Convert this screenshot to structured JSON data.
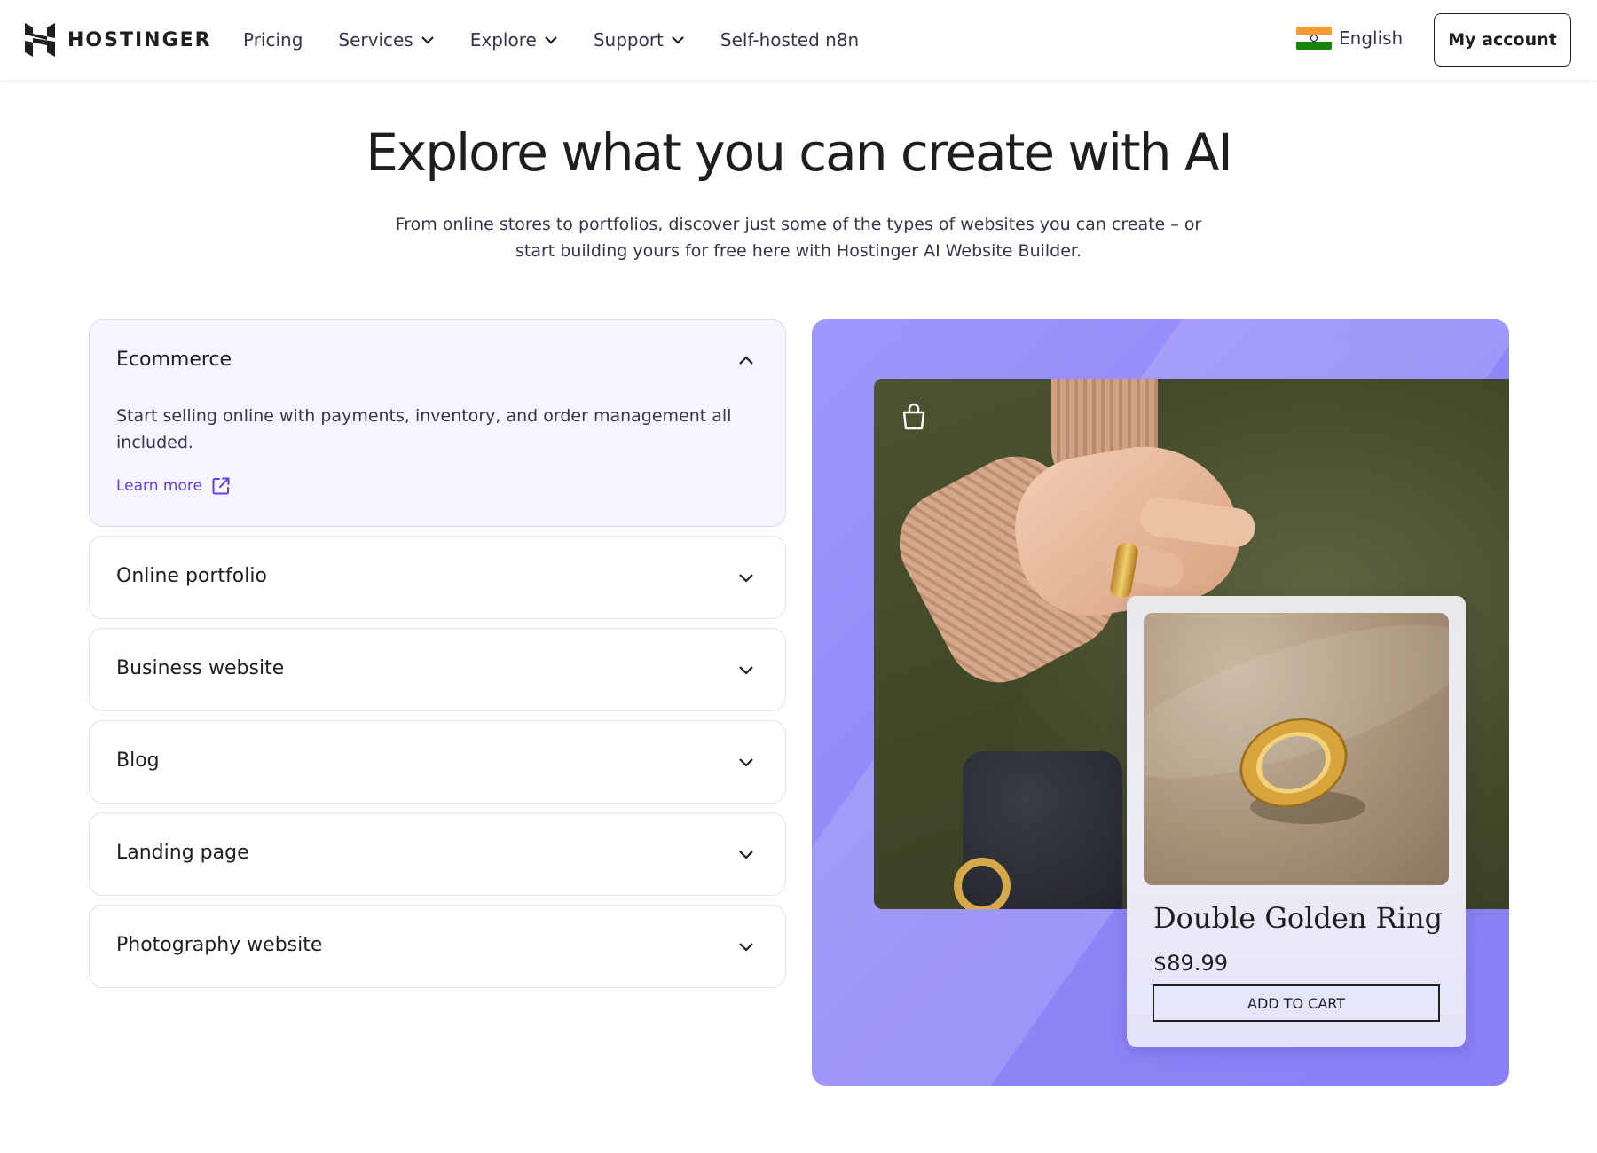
{
  "header": {
    "logo_text": "HOSTINGER",
    "nav": [
      {
        "label": "Pricing",
        "has_dropdown": false
      },
      {
        "label": "Services",
        "has_dropdown": true
      },
      {
        "label": "Explore",
        "has_dropdown": true
      },
      {
        "label": "Support",
        "has_dropdown": true
      },
      {
        "label": "Self-hosted n8n",
        "has_dropdown": false
      }
    ],
    "language": "English",
    "account_label": "My account"
  },
  "hero": {
    "title": "Explore what you can create with AI",
    "subtitle": "From online stores to portfolios, discover just some of the types of websites you can create – or start building yours for free here with Hostinger AI Website Builder."
  },
  "accordion": {
    "items": [
      {
        "title": "Ecommerce",
        "open": true,
        "description": "Start selling online with payments, inventory, and order management all included.",
        "link": "Learn more"
      },
      {
        "title": "Online portfolio",
        "open": false
      },
      {
        "title": "Business website",
        "open": false
      },
      {
        "title": "Blog",
        "open": false
      },
      {
        "title": "Landing page",
        "open": false
      },
      {
        "title": "Photography website",
        "open": false
      }
    ]
  },
  "preview": {
    "product_name": "Double Golden Ring",
    "product_price": "$89.99",
    "cart_label": "ADD TO CART"
  },
  "colors": {
    "accent": "#673de6",
    "panel_purple": "#8f86f7",
    "open_item_bg": "#f4f5ff"
  },
  "icons": {
    "logo": "hostinger-logo-icon",
    "dropdown": "chevron-down-icon",
    "collapse": "chevron-up-icon",
    "external_link": "external-link-icon",
    "shopping_bag": "shopping-bag-icon",
    "flag": "india-flag-icon"
  }
}
